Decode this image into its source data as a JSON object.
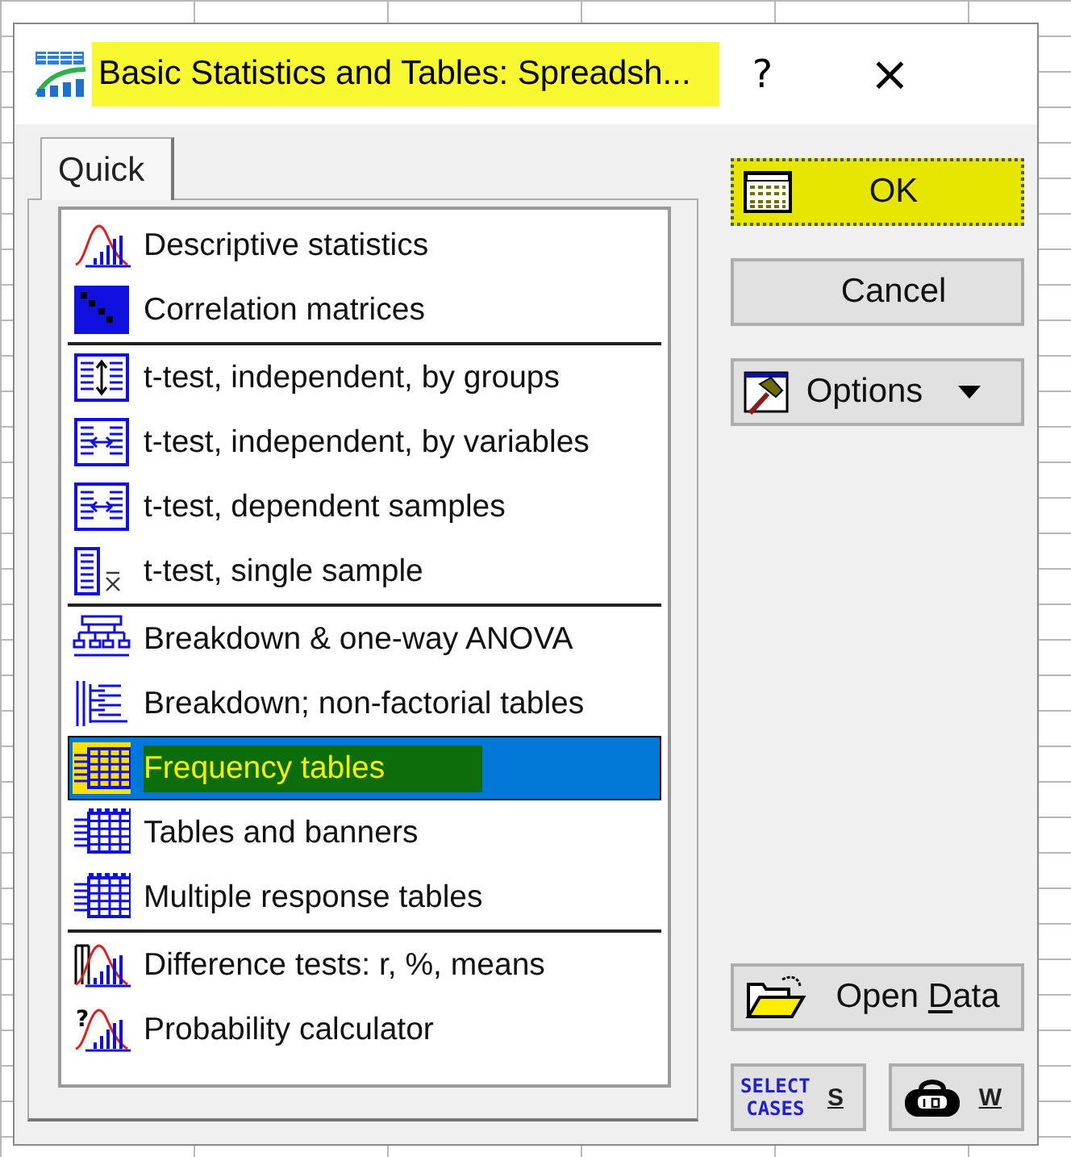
{
  "window": {
    "title": "Basic Statistics and Tables: Spreadsh...",
    "title_highlighted": true,
    "help": "?",
    "close": "×"
  },
  "tabs": [
    {
      "label": "Quick",
      "selected": true
    }
  ],
  "groups": [
    {
      "items": [
        {
          "kind": "distribution",
          "label": "Descriptive statistics",
          "selected": false,
          "highlighted": false
        },
        {
          "kind": "matrix",
          "label": "Correlation matrices",
          "selected": false,
          "highlighted": false
        }
      ]
    },
    {
      "items": [
        {
          "kind": "groups",
          "label": "t-test, independent, by groups",
          "selected": false,
          "highlighted": false
        },
        {
          "kind": "variables",
          "label": "t-test, independent, by variables",
          "selected": false,
          "highlighted": false
        },
        {
          "kind": "dependent",
          "label": "t-test, dependent samples",
          "selected": false,
          "highlighted": false
        },
        {
          "kind": "single",
          "label": "t-test, single sample",
          "selected": false,
          "highlighted": false
        }
      ]
    },
    {
      "items": [
        {
          "kind": "tree",
          "label": "Breakdown & one-way ANOVA",
          "selected": false,
          "highlighted": false
        },
        {
          "kind": "nonfactorial",
          "label": "Breakdown; non-factorial tables",
          "selected": false,
          "highlighted": false
        },
        {
          "kind": "frequency",
          "label": "Frequency tables",
          "selected": true,
          "highlighted": true
        },
        {
          "kind": "tables",
          "label": "Tables and banners",
          "selected": false,
          "highlighted": false
        },
        {
          "kind": "tables",
          "label": "Multiple response tables",
          "selected": false,
          "highlighted": false
        }
      ]
    },
    {
      "items": [
        {
          "kind": "difference",
          "label": "Difference tests: r, %, means",
          "selected": false,
          "highlighted": false
        },
        {
          "kind": "probability",
          "icon_text": "?",
          "label": "Probability calculator",
          "selected": false,
          "highlighted": false
        }
      ]
    }
  ],
  "buttons": [
    {
      "kind": "ok",
      "label": "OK",
      "highlighted": true,
      "focused": true
    },
    {
      "kind": "cancel",
      "label": "Cancel",
      "highlighted": false,
      "focused": false
    },
    {
      "kind": "options",
      "label": "Options",
      "highlighted": false,
      "focused": false
    }
  ],
  "bottom_buttons": [
    {
      "kind": "open",
      "label_before": "Open ",
      "mnemonic": "D",
      "label_after": "ata"
    },
    {
      "kind": "select",
      "icon_text": [
        "SELECT",
        "CASES"
      ],
      "mnemonic": "S"
    },
    {
      "kind": "weight",
      "mnemonic": "W"
    }
  ]
}
